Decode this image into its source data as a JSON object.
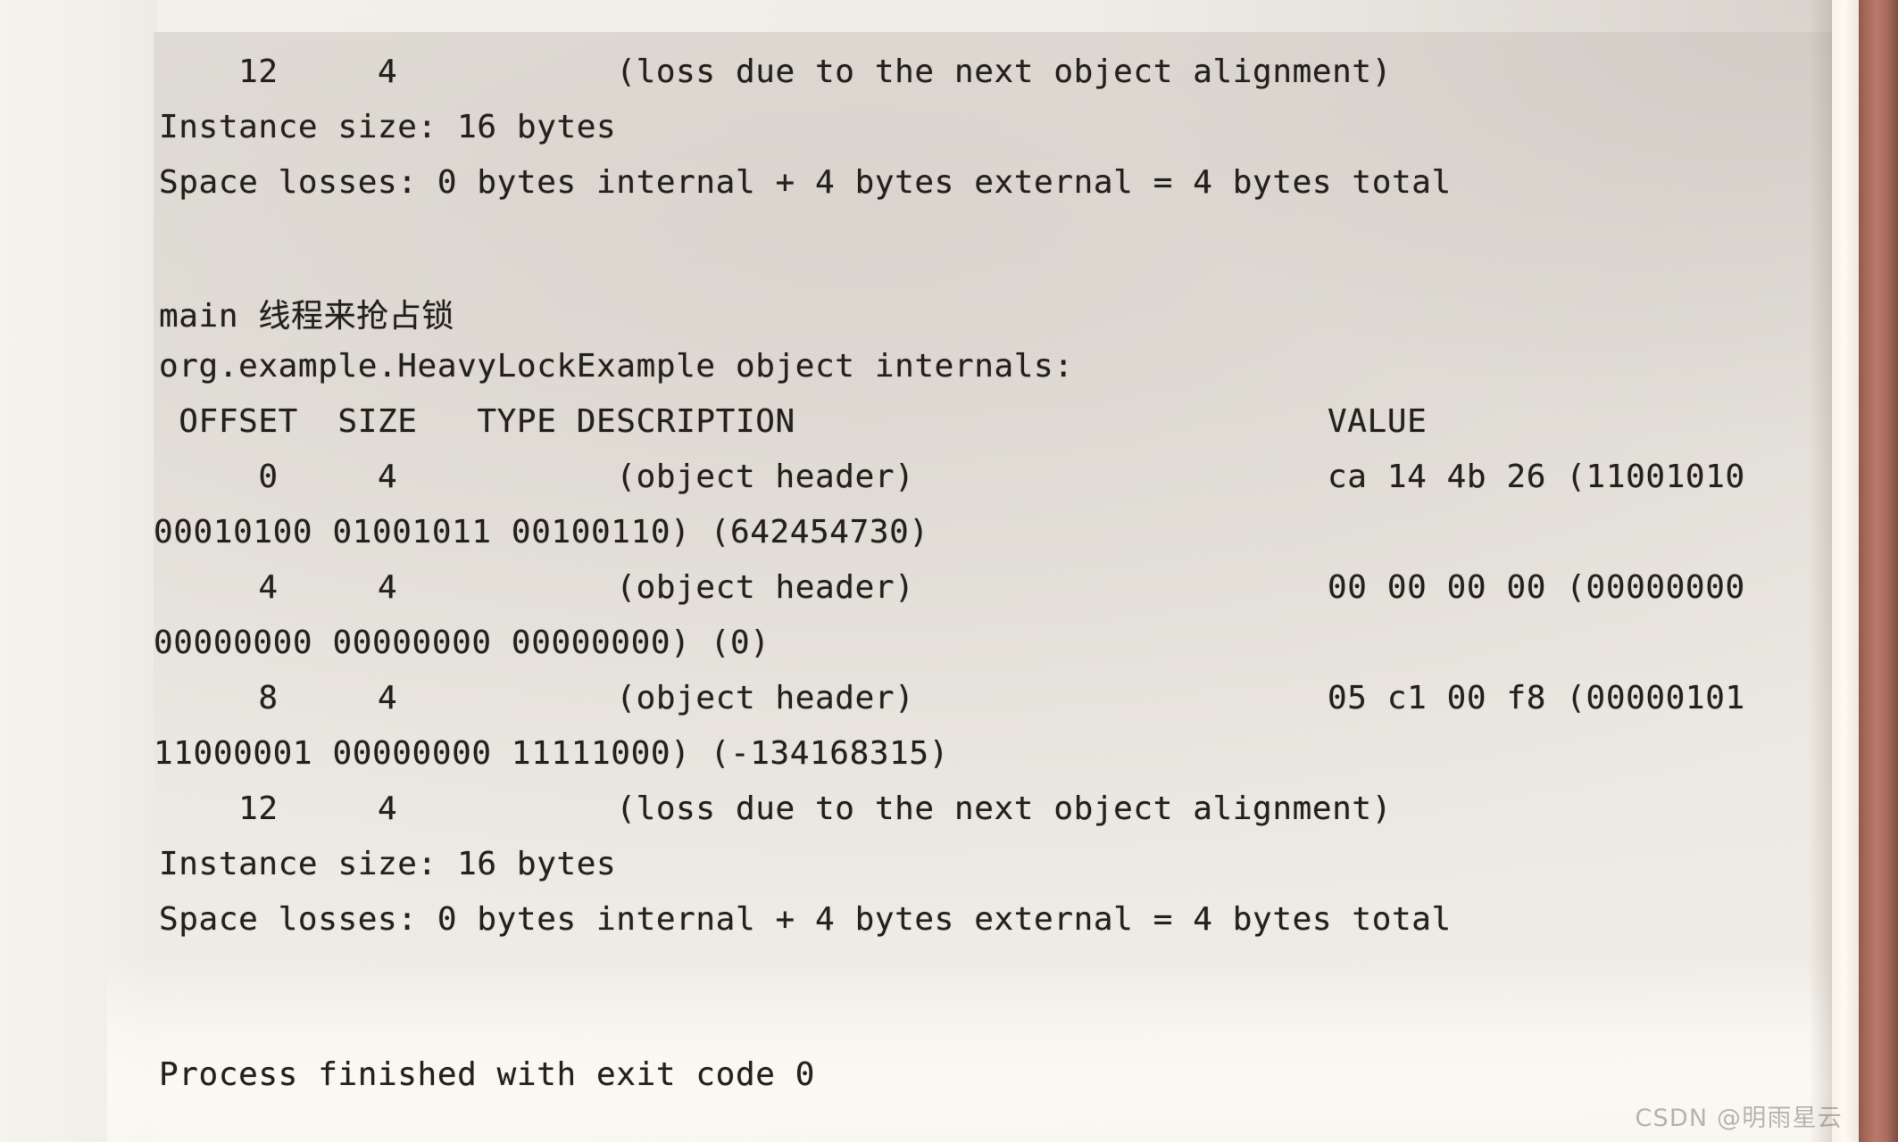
{
  "scene": {
    "kind": "photograph-of-printed-page",
    "paper_color": "#eeebe4",
    "ink_color": "#241f1c",
    "book_edge_color": "#a9685a"
  },
  "watermark": {
    "text": "CSDN @明雨星云"
  },
  "console_output": {
    "top_block": {
      "alignment_loss_row": {
        "offset": "12",
        "size": "4",
        "description": "(loss due to the next object alignment)",
        "full_line": "    12     4           (loss due to the next object alignment)"
      },
      "instance_size": "Instance size: 16 bytes",
      "space_losses": "Space losses: 0 bytes internal + 4 bytes external = 4 bytes total"
    },
    "annotation": {
      "label": "main 线程来抢占锁",
      "latin_part": "main ",
      "cjk_part": "线程来抢占锁"
    },
    "object_internals": {
      "title": "org.example.HeavyLockExample object internals:",
      "header": {
        "offset": "OFFSET",
        "size": "SIZE",
        "type_description": "TYPE DESCRIPTION",
        "value": "VALUE",
        "full_line": " OFFSET  SIZE   TYPE DESCRIPTION"
      },
      "rows": [
        {
          "offset": "0",
          "size": "4",
          "description": "(object header)",
          "value_head": "ca 14 4b 26 (11001010",
          "value_tail": "00010100 01001011 00100110) (642454730)",
          "decimal": "642454730",
          "hex_bytes": "ca 14 4b 26",
          "binary": "11001010 00010100 01001011 00100110",
          "row_line": "     0     4           (object header)"
        },
        {
          "offset": "4",
          "size": "4",
          "description": "(object header)",
          "value_head": "00 00 00 00 (00000000",
          "value_tail": "00000000 00000000 00000000) (0)",
          "decimal": "0",
          "hex_bytes": "00 00 00 00",
          "binary": "00000000 00000000 00000000 00000000",
          "row_line": "     4     4           (object header)"
        },
        {
          "offset": "8",
          "size": "4",
          "description": "(object header)",
          "value_head": "05 c1 00 f8 (00000101",
          "value_tail": "11000001 00000000 11111000) (-134168315)",
          "decimal": "-134168315",
          "hex_bytes": "05 c1 00 f8",
          "binary": "00000101 11000001 00000000 11111000",
          "row_line": "     8     4           (object header)"
        }
      ],
      "alignment_loss_row": {
        "offset": "12",
        "size": "4",
        "description": "(loss due to the next object alignment)",
        "full_line": "    12     4           (loss due to the next object alignment)"
      },
      "instance_size": "Instance size: 16 bytes",
      "space_losses": "Space losses: 0 bytes internal + 4 bytes external = 4 bytes total"
    },
    "footer": {
      "process_exit": "Process finished with exit code 0"
    }
  }
}
